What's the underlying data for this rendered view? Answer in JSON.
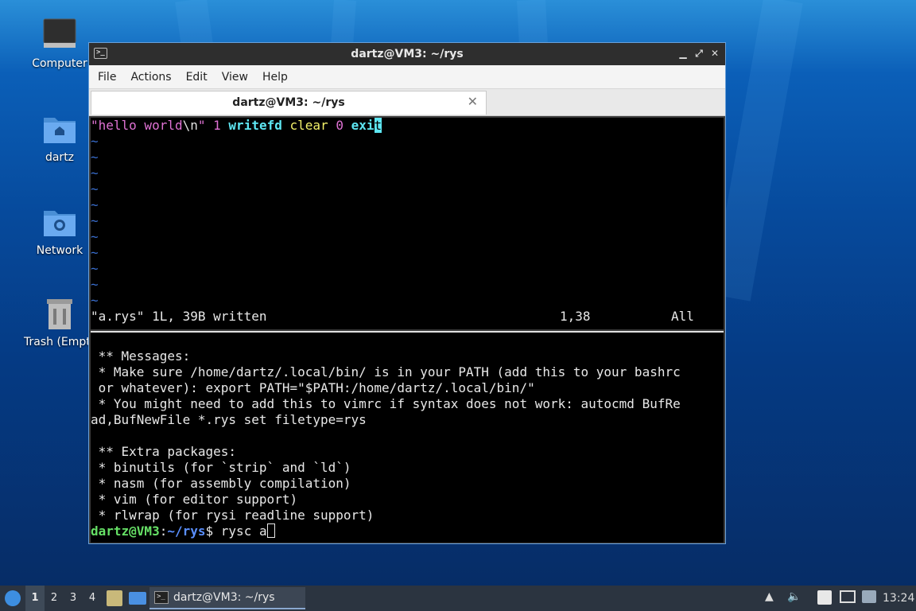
{
  "desktop": {
    "icons": [
      {
        "label": "Computer",
        "icon": "computer-icon"
      },
      {
        "label": "dartz",
        "icon": "home-folder-icon"
      },
      {
        "label": "Network",
        "icon": "network-folder-icon"
      },
      {
        "label": "Trash (Empty)",
        "icon": "trash-icon"
      }
    ]
  },
  "window": {
    "title": "dartz@VM3: ~/rys",
    "buttons": {
      "minimize": "▁",
      "maximize": "⤢",
      "close": "✕"
    },
    "menu": [
      "File",
      "Actions",
      "Edit",
      "View",
      "Help"
    ],
    "tab": {
      "title": "dartz@VM3: ~/rys",
      "close": "✕"
    }
  },
  "vim": {
    "tokens": {
      "str_open": "\"hello world",
      "esc": "\\n",
      "str_close": "\"",
      "num1": "1",
      "fn1": "writefd",
      "kw1": "clear",
      "num2": "0",
      "fn2_head": "exi",
      "fn2_cursor": "t"
    },
    "tilde": "~",
    "status_msg": "\"a.rys\" 1L, 39B written",
    "position": "1,38",
    "scroll": "All"
  },
  "shell": {
    "lines": [
      "",
      " ** Messages:",
      " * Make sure /home/dartz/.local/bin/ is in your PATH (add this to your bashrc",
      " or whatever): export PATH=\"$PATH:/home/dartz/.local/bin/\"",
      " * You might need to add this to vimrc if syntax does not work: autocmd BufRe",
      "ad,BufNewFile *.rys set filetype=rys",
      "",
      " ** Extra packages:",
      " * binutils (for `strip` and `ld`)",
      " * nasm (for assembly compilation)",
      " * vim (for editor support)",
      " * rlwrap (for rysi readline support)"
    ],
    "prompt_user": "dartz@VM3",
    "prompt_sep": ":",
    "prompt_path": "~/rys",
    "prompt_dollar": "$",
    "command": " rysc a"
  },
  "taskbar": {
    "workspaces": [
      "1",
      "2",
      "3",
      "4"
    ],
    "active_workspace": "1",
    "task_label": "dartz@VM3: ~/rys",
    "clock": "13:24"
  }
}
